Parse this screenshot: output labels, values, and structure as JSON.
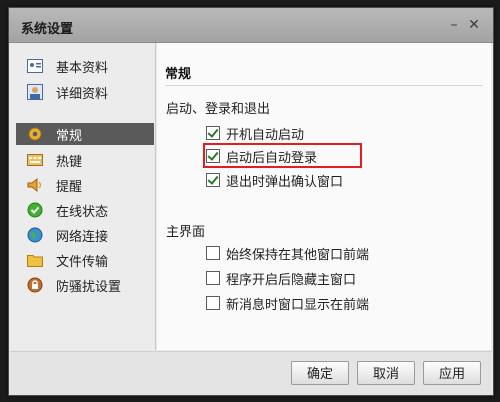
{
  "window": {
    "title": "系统设置"
  },
  "sidebar": {
    "items": [
      {
        "label": "基本资料",
        "icon": "id-card-icon"
      },
      {
        "label": "详细资料",
        "icon": "profile-card-icon"
      },
      {
        "label": "常规",
        "icon": "gear-icon",
        "active": true
      },
      {
        "label": "热键",
        "icon": "keyboard-icon"
      },
      {
        "label": "提醒",
        "icon": "speaker-icon"
      },
      {
        "label": "在线状态",
        "icon": "status-check-icon"
      },
      {
        "label": "网络连接",
        "icon": "globe-icon"
      },
      {
        "label": "文件传输",
        "icon": "folder-icon"
      },
      {
        "label": "防骚扰设置",
        "icon": "lock-icon"
      }
    ]
  },
  "content": {
    "heading": "常规",
    "section1": {
      "label": "启动、登录和退出",
      "options": [
        {
          "label": "开机自动启动",
          "checked": true
        },
        {
          "label": "启动后自动登录",
          "checked": true
        },
        {
          "label": "退出时弹出确认窗口",
          "checked": true
        }
      ]
    },
    "section2": {
      "label": "主界面",
      "options": [
        {
          "label": "始终保持在其他窗口前端",
          "checked": false
        },
        {
          "label": "程序开启后隐藏主窗口",
          "checked": false
        },
        {
          "label": "新消息时窗口显示在前端",
          "checked": false
        }
      ]
    }
  },
  "footer": {
    "ok": "确定",
    "cancel": "取消",
    "apply": "应用"
  },
  "colors": {
    "highlight": "#e02020",
    "active_nav": "#5a5a5a",
    "check": "#2a7a2a"
  }
}
